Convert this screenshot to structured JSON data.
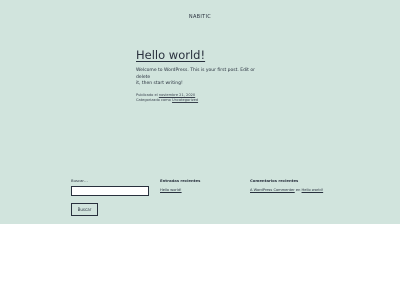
{
  "site": {
    "title": "NABITIC"
  },
  "post": {
    "title": "Hello world!",
    "body_line1": "Welcome to WordPress. This is your first post. Edit or delete",
    "body_line2": "it, then start writing!",
    "published_prefix": "Publicado el",
    "published_date": "noviembre 21, 2020",
    "category_prefix": "Categorizado como",
    "category": "Uncategorized"
  },
  "search": {
    "label": "Buscar…",
    "value": "",
    "button_label": "Buscar"
  },
  "recent_posts": {
    "title": "Entradas recientes",
    "items": [
      "Hello world!"
    ]
  },
  "recent_comments": {
    "title": "Comentarios recientes",
    "author": "A WordPress Commenter",
    "connector": "en",
    "post": "Hello world!"
  },
  "colors": {
    "background": "#d1e4dd",
    "text": "#28303d",
    "footer_area": "#ffffff"
  }
}
